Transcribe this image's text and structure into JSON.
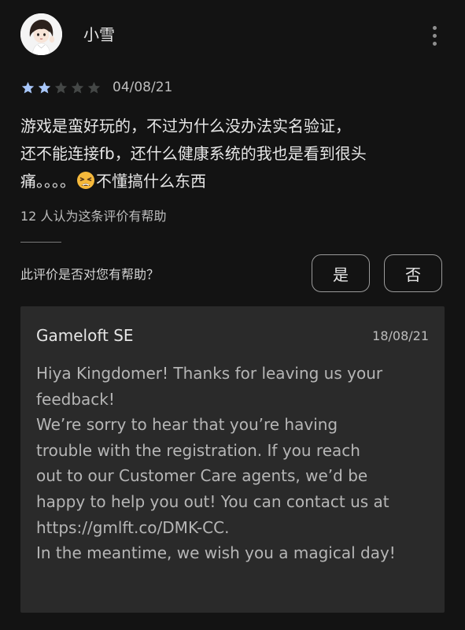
{
  "review": {
    "username": "小雪",
    "rating": 2,
    "rating_max": 5,
    "date": "04/08/21",
    "text_before_emoji": "游戏是蛮好玩的，不过为什么没办法实名验证，\n还不能连接fb，还什么健康系统的我也是看到很头\n痛。。。。",
    "emoji": "tired-face-emoji",
    "text_after_emoji": "不懂搞什么东西",
    "helpful_count": "12 人认为这条评价有帮助",
    "helpful_question": "此评价是否对您有帮助？",
    "yes_label": "是",
    "no_label": "否",
    "menu_icon": "more-vert-icon"
  },
  "developer_reply": {
    "name": "Gameloft SE",
    "date": "18/08/21",
    "text": "Hiya Kingdomer! Thanks for leaving us your\nfeedback!\nWe’re sorry to hear that you’re having\ntrouble with the registration. If you reach\nout to our Customer Care agents, we’d be\nhappy to help you out! You can contact us at\nhttps://gmlft.co/DMK-CC.\nIn the meantime, we wish you a magical day!"
  },
  "colors": {
    "background": "#131313",
    "star_filled": "#a8c7fa",
    "star_empty": "#444746",
    "card": "#2a2a2a"
  }
}
